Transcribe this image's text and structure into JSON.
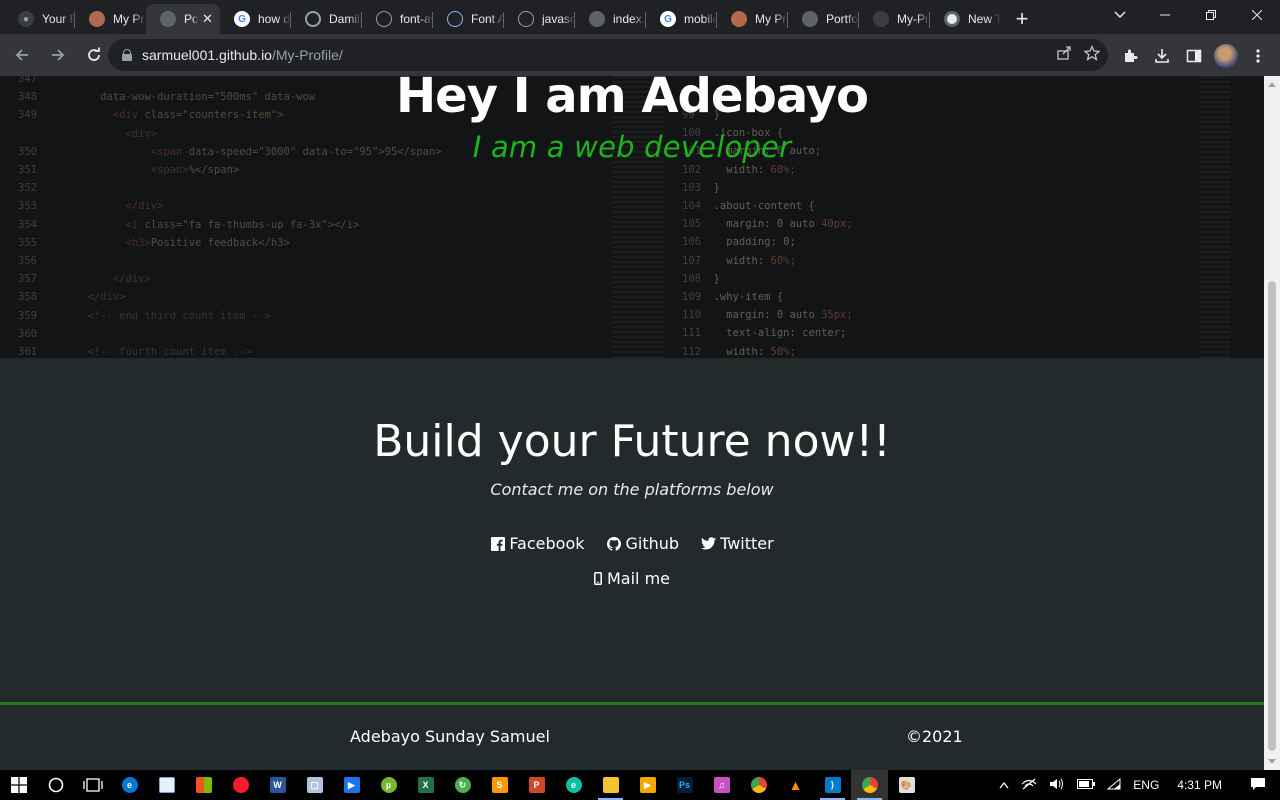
{
  "browser": {
    "tabs": [
      {
        "title": "Your Profile",
        "icon": "github-icon",
        "color": "#6e7681"
      },
      {
        "title": "My Profile",
        "icon": "avatar-icon",
        "color": "#b06a50"
      },
      {
        "title": "Portfolio",
        "icon": "github-icon",
        "color": "#6e7681",
        "active": true
      },
      {
        "title": "how do",
        "icon": "google-icon",
        "color": "#4285f4"
      },
      {
        "title": "Damilola",
        "icon": "loading-icon",
        "color": "#9aa0a6"
      },
      {
        "title": "font-awesome",
        "icon": "globe-icon",
        "color": "#9aa0a6"
      },
      {
        "title": "Font Awesome",
        "icon": "globe-icon",
        "color": "#8ab4f8"
      },
      {
        "title": "javascript",
        "icon": "chrome-icon",
        "color": "#9aa0a6"
      },
      {
        "title": "index.html",
        "icon": "globe-icon",
        "color": "#9aa0a6"
      },
      {
        "title": "mobile",
        "icon": "google-icon",
        "color": "#4285f4"
      },
      {
        "title": "My Profile",
        "icon": "avatar-icon",
        "color": "#b06a50"
      },
      {
        "title": "Portfolio",
        "icon": "globe-icon",
        "color": "#9aa0a6"
      },
      {
        "title": "My-Profile",
        "icon": "github-icon",
        "color": "#6e7681"
      },
      {
        "title": "New Tab",
        "icon": "chrome-icon",
        "color": "#e8eaed"
      }
    ],
    "close_tab_glyph": "✕",
    "new_tab_glyph": "+",
    "url_host": "sarmuel001.github.io",
    "url_path": "/My-Profile/"
  },
  "hero": {
    "title": "Hey I am Adebayo",
    "subtitle": "I am a web developer"
  },
  "contact": {
    "title": "Build your Future now!!",
    "subtitle": "Contact me on the platforms below",
    "links": {
      "facebook": "Facebook",
      "github": "Github",
      "twitter": "Twitter",
      "mail": "Mail me"
    }
  },
  "footer": {
    "name": "Adebayo Sunday Samuel",
    "copyright": "©2021"
  },
  "taskbar": {
    "language": "ENG",
    "time": "4:31 PM"
  },
  "colors": {
    "accent_green": "#1db31d",
    "footer_line": "#1f7a1f",
    "page_bg": "#222a2c"
  }
}
